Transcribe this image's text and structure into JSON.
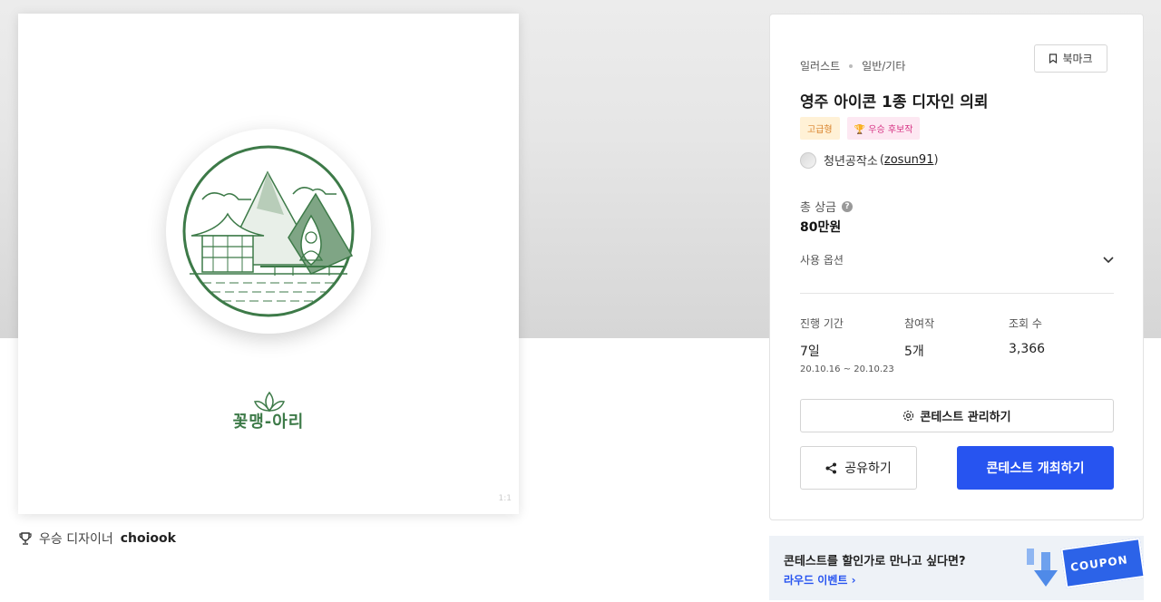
{
  "image_card": {
    "brand_text": "꽃맹-아리",
    "corner_mark": "1:1"
  },
  "winner": {
    "prefix": "우승 디자이너",
    "name": "choiook"
  },
  "panel": {
    "bookmark_label": "북마크",
    "breadcrumb": [
      "일러스트",
      "일반/기타"
    ],
    "title": "영주 아이콘 1종 디자인 의뢰",
    "badges": {
      "grade": "고급형",
      "winner": "우승 후보작"
    },
    "host": {
      "name": "청년공작소",
      "id_open": "(",
      "id": "zosun91",
      "id_close": ")"
    },
    "prize": {
      "label": "총 상금",
      "help": "?",
      "value": "80만원"
    },
    "options_label": "사용 옵션",
    "stats": {
      "period": {
        "label": "진행 기간",
        "value": "7일",
        "range": "20.10.16 ~ 20.10.23"
      },
      "entries": {
        "label": "참여작",
        "value": "5개"
      },
      "views": {
        "label": "조회 수",
        "value": "3,366"
      }
    },
    "manage_label": "콘테스트 관리하기",
    "share_label": "공유하기",
    "host_label": "콘테스트 개최하기"
  },
  "banner": {
    "title": "콘테스트를 할인가로 만나고 싶다면?",
    "link": "라우드 이벤트",
    "coupon": "COUPON"
  },
  "colors": {
    "accent": "#2754f0",
    "logo_green": "#3d7a48",
    "grade_badge": "#d9822b",
    "winner_badge": "#d63384"
  }
}
